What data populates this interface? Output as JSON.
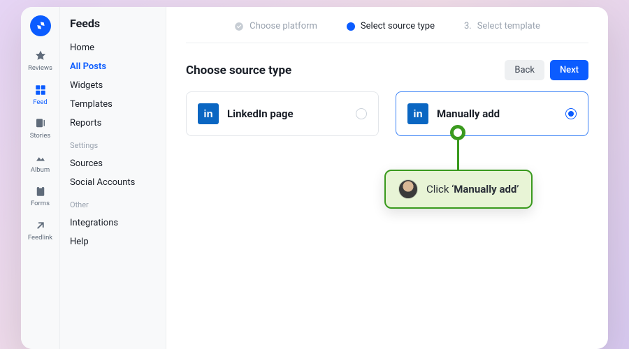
{
  "rail": {
    "items": [
      {
        "label": "Reviews"
      },
      {
        "label": "Feed"
      },
      {
        "label": "Stories"
      },
      {
        "label": "Album"
      },
      {
        "label": "Forms"
      },
      {
        "label": "Feedlink"
      }
    ]
  },
  "sidebar": {
    "title": "Feeds",
    "primary": [
      {
        "label": "Home"
      },
      {
        "label": "All Posts"
      },
      {
        "label": "Widgets"
      },
      {
        "label": "Templates"
      },
      {
        "label": "Reports"
      }
    ],
    "settings_label": "Settings",
    "settings": [
      {
        "label": "Sources"
      },
      {
        "label": "Social Accounts"
      }
    ],
    "other_label": "Other",
    "other": [
      {
        "label": "Integrations"
      },
      {
        "label": "Help"
      }
    ]
  },
  "stepper": {
    "s1": "Choose platform",
    "s2": "Select source type",
    "s3_num": "3.",
    "s3": "Select template"
  },
  "main": {
    "heading": "Choose source type",
    "back": "Back",
    "next": "Next",
    "cards": [
      {
        "title": "LinkedIn page",
        "badge": "in"
      },
      {
        "title": "Manually add",
        "badge": "in"
      }
    ]
  },
  "tooltip": {
    "prefix": "Click ",
    "q1": "‘",
    "bold": "Manually add",
    "q2": "’"
  }
}
